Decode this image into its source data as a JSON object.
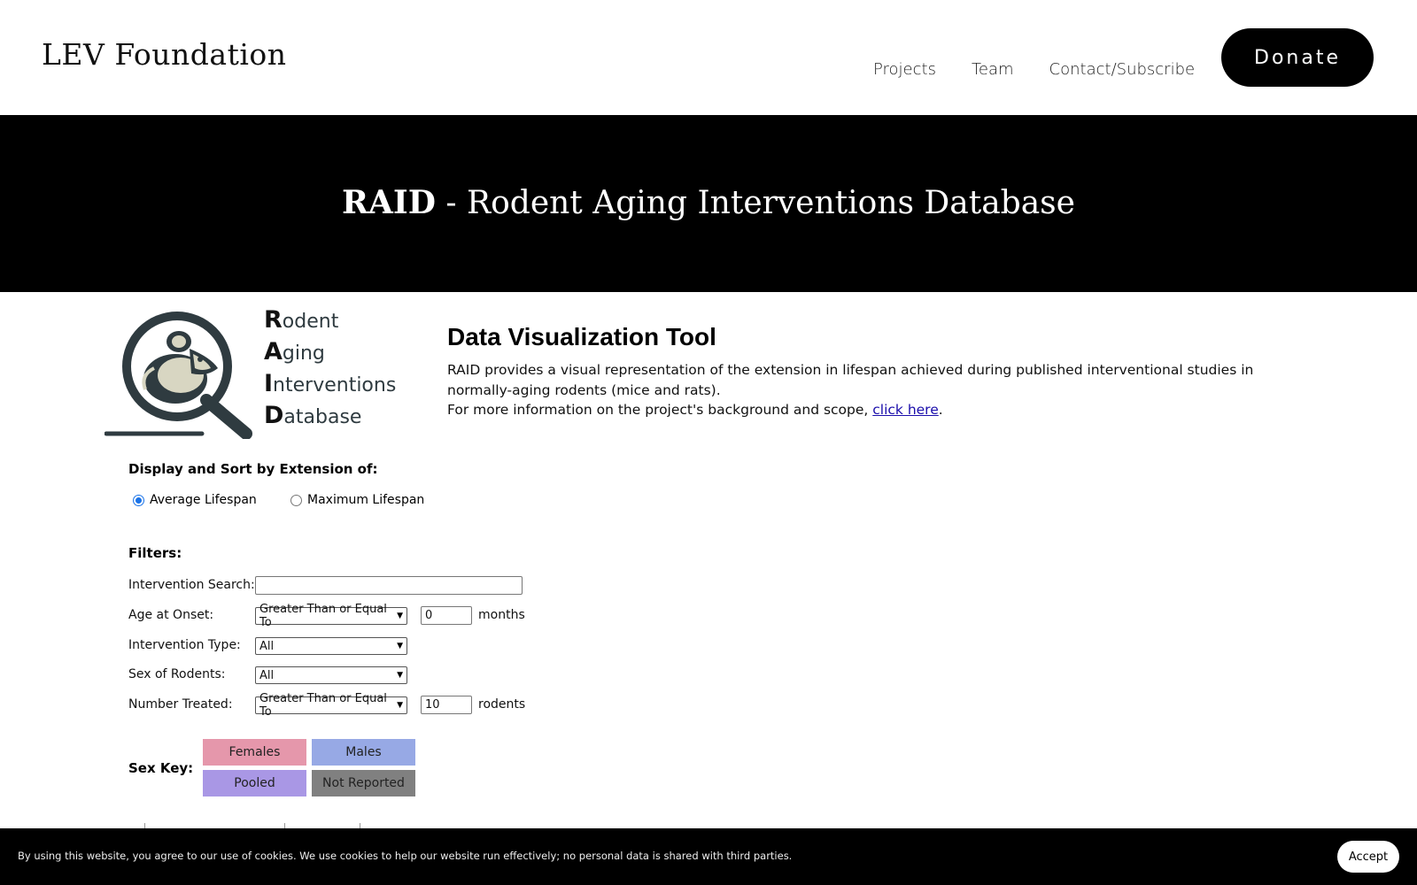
{
  "header": {
    "site_title": "LEV Foundation",
    "nav": [
      "Projects",
      "Team",
      "Contact/Subscribe"
    ],
    "donate_label": "Donate"
  },
  "hero": {
    "title_bold": "RAID",
    "title_rest": " - Rodent Aging Interventions Database"
  },
  "logo": {
    "lines": [
      {
        "cap": "R",
        "rest": "odent"
      },
      {
        "cap": "A",
        "rest": "ging"
      },
      {
        "cap": "I",
        "rest": "nterventions"
      },
      {
        "cap": "D",
        "rest": "atabase"
      }
    ]
  },
  "intro": {
    "title": "Data Visualization Tool",
    "line1": "RAID provides a visual representation of the extension in lifespan achieved during published interventional studies in normally-aging rodents (mice and rats).",
    "line2_prefix": "For more information on the project's background and scope, ",
    "link_text": "click here",
    "line2_suffix": "."
  },
  "sort": {
    "label": "Display and Sort by Extension of:",
    "options": [
      {
        "label": "Average Lifespan",
        "checked": true
      },
      {
        "label": "Maximum Lifespan",
        "checked": false
      }
    ]
  },
  "filters": {
    "label": "Filters:",
    "intervention_search": {
      "label": "Intervention Search:",
      "value": ""
    },
    "age_at_onset": {
      "label": "Age at Onset:",
      "operator": "Greater Than or Equal To",
      "value": "0",
      "unit": "months"
    },
    "intervention_type": {
      "label": "Intervention Type:",
      "value": "All"
    },
    "sex_of_rodents": {
      "label": "Sex of Rodents:",
      "value": "All"
    },
    "number_treated": {
      "label": "Number Treated:",
      "operator": "Greater Than or Equal To",
      "value": "10",
      "unit": "rodents"
    }
  },
  "sex_key": {
    "label": "Sex Key:",
    "items": [
      {
        "label": "Females",
        "color": "#e597ab"
      },
      {
        "label": "Males",
        "color": "#97a9e5"
      },
      {
        "label": "Pooled",
        "color": "#a997e5"
      },
      {
        "label": "Not Reported",
        "color": "#808080"
      }
    ]
  },
  "cookie": {
    "text": "By using this website, you agree to our use of cookies. We use cookies to help our website run effectively; no personal data is shared with third parties.",
    "accept_label": "Accept"
  }
}
